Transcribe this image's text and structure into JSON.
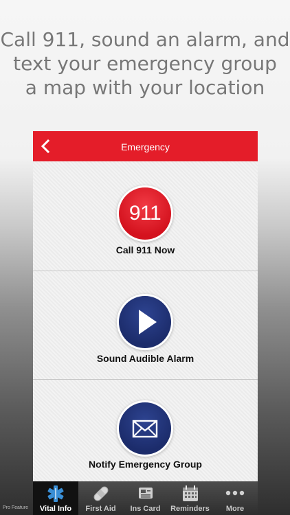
{
  "headline": {
    "line1": "Call 911, sound an alarm, and",
    "line2": "text your emergency group",
    "line3": "a map with your location"
  },
  "navbar": {
    "title": "Emergency",
    "back_icon": "chevron-left-icon"
  },
  "actions": [
    {
      "icon_text": "911",
      "label": "Call 911 Now",
      "color": "#e41d29"
    },
    {
      "icon": "play-icon",
      "label": "Sound Audible Alarm",
      "color": "#1f2f70"
    },
    {
      "icon": "envelope-icon",
      "label": "Notify Emergency Group",
      "color": "#1f2f70"
    }
  ],
  "tabbar": {
    "side_note": "Pro Feature",
    "tabs": [
      {
        "label": "Vital Info",
        "icon": "medical-star-icon",
        "active": true
      },
      {
        "label": "First Aid",
        "icon": "bandage-icon",
        "active": false
      },
      {
        "label": "Ins Card",
        "icon": "card-icon",
        "active": false
      },
      {
        "label": "Reminders",
        "icon": "calendar-icon",
        "active": false
      },
      {
        "label": "More",
        "icon": "more-dots-icon",
        "active": false
      }
    ]
  },
  "colors": {
    "accent_red": "#e41d29",
    "navy": "#1f2f70",
    "tab_active": "#3a8fd6"
  }
}
